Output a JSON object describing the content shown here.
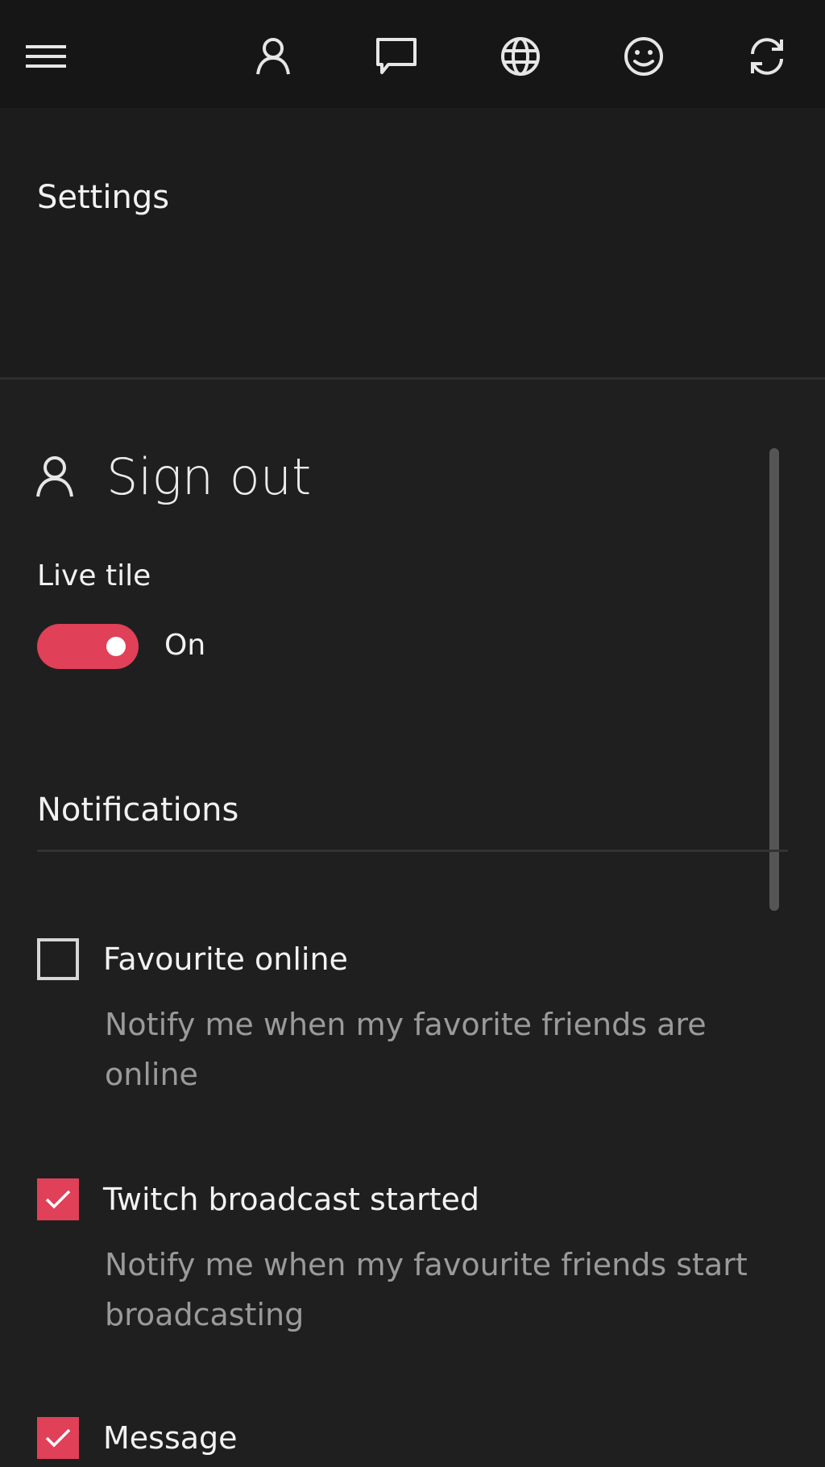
{
  "topbar": {
    "icons": [
      "hamburger-menu-icon",
      "person-icon",
      "chat-icon",
      "globe-icon",
      "smiley-icon",
      "sync-icon"
    ]
  },
  "header": {
    "title": "Settings"
  },
  "account": {
    "signout_label": "Sign out"
  },
  "live_tile": {
    "label": "Live tile",
    "state": "On",
    "on": true
  },
  "notifications": {
    "title": "Notifications",
    "items": [
      {
        "label": "Favourite online",
        "description": "Notify me when my favorite friends are online",
        "checked": false
      },
      {
        "label": "Twitch broadcast started",
        "description": "Notify me when my favourite friends start broadcasting",
        "checked": true
      },
      {
        "label": "Message",
        "description": "",
        "checked": true
      }
    ]
  },
  "colors": {
    "accent": "#e04058",
    "background": "#1f1f1f",
    "topbar": "#161616",
    "secondary_text": "#9a9a9a"
  }
}
